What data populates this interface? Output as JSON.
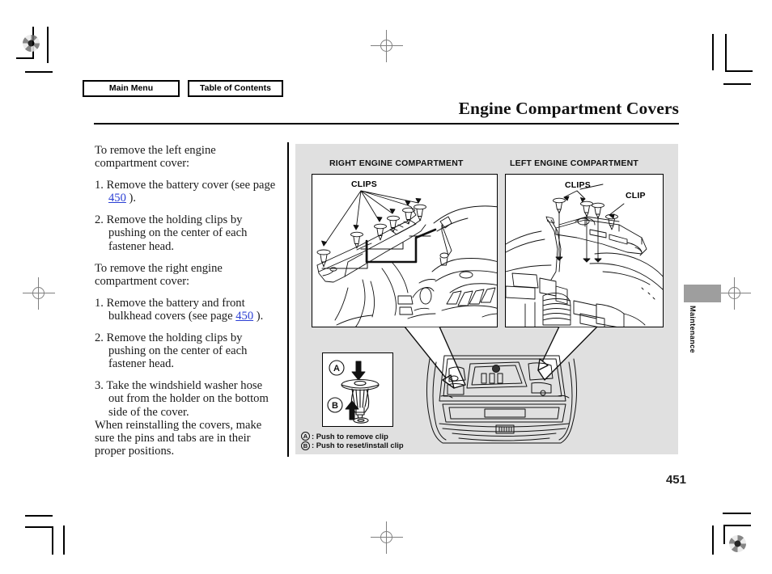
{
  "document": {
    "page_title": "Engine Compartment Covers",
    "page_number": "451",
    "side_tab_label": "Maintenance"
  },
  "navbar": {
    "main_menu_label": "Main Menu",
    "table_of_contents_label": "Table of Contents"
  },
  "body_text": {
    "intro_left": "To remove the left engine compartment cover:",
    "left_steps": [
      {
        "number": "1.",
        "text_before": "Remove the battery cover (see page ",
        "page_ref": "450",
        "text_after": " )."
      },
      {
        "number": "2.",
        "text_before": "Remove the holding clips by pushing on the center of each fastener head.",
        "page_ref": "",
        "text_after": ""
      }
    ],
    "intro_right": "To remove the right engine compartment cover:",
    "right_steps": [
      {
        "number": "1.",
        "text_before": "Remove the battery and front bulkhead covers (see page ",
        "page_ref": "450",
        "text_after": " )."
      },
      {
        "number": "2.",
        "text_before": "Remove the holding clips by pushing on the center of each fastener head.",
        "page_ref": "",
        "text_after": ""
      },
      {
        "number": "3.",
        "text_before": "Take the windshield washer hose out from the holder on the bottom side of the cover.",
        "page_ref": "",
        "text_after": ""
      }
    ],
    "closing": "When reinstalling the covers, make sure the pins and tabs are in their proper positions."
  },
  "figure": {
    "right_compartment_title": "RIGHT ENGINE COMPARTMENT",
    "left_compartment_title": "LEFT ENGINE COMPARTMENT",
    "right_clips_label": "CLIPS",
    "left_clips_label": "CLIPS",
    "left_clip_label": "CLIP",
    "clip_detail": {
      "marker_a": "A",
      "marker_b": "B"
    },
    "legend": [
      {
        "mark": "A",
        "text": ": Push to remove clip"
      },
      {
        "mark": "B",
        "text": ": Push to reset/install clip"
      }
    ]
  },
  "colors": {
    "panel_background": "#e0e0e0",
    "page_ref_link": "#2b3fd4",
    "side_tab": "#9e9e9e",
    "rule": "#000000"
  }
}
